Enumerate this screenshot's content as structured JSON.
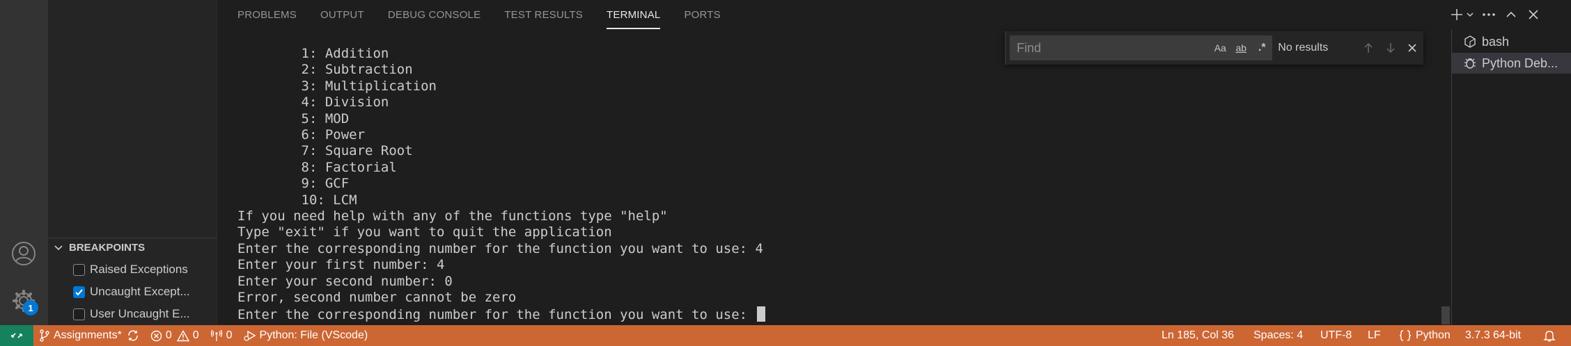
{
  "panel": {
    "tabs": [
      "PROBLEMS",
      "OUTPUT",
      "DEBUG CONSOLE",
      "TEST RESULTS",
      "TERMINAL",
      "PORTS"
    ],
    "active_tab": "TERMINAL"
  },
  "terminal": {
    "lines": [
      "        1: Addition",
      "        2: Subtraction",
      "        3: Multiplication",
      "        4: Division",
      "        5: MOD",
      "        6: Power",
      "        7: Square Root",
      "        8: Factorial",
      "        9: GCF",
      "        10: LCM",
      "If you need help with any of the functions type \"help\"",
      "Type \"exit\" if you want to quit the application",
      "Enter the corresponding number for the function you want to use: 4",
      "Enter your first number: 4",
      "Enter your second number: 0",
      "Error, second number cannot be zero",
      "Enter the corresponding number for the function you want to use: "
    ]
  },
  "find": {
    "placeholder": "Find",
    "value": "",
    "match_case_label": "Aa",
    "whole_word_label": "ab",
    "regex_label": ".*",
    "status": "No results"
  },
  "terminal_list": {
    "items": [
      {
        "label": "bash",
        "icon": "terminal-icon",
        "selected": false
      },
      {
        "label": "Python Deb...",
        "icon": "debug-icon",
        "selected": true
      }
    ]
  },
  "sidebar": {
    "breakpoints_title": "BREAKPOINTS",
    "breakpoints": [
      {
        "label": "Raised Exceptions",
        "checked": false
      },
      {
        "label": "Uncaught Except...",
        "checked": true
      },
      {
        "label": "User Uncaught E...",
        "checked": false
      }
    ]
  },
  "activity": {
    "settings_badge": "1"
  },
  "statusbar": {
    "branch": "Assignments*",
    "errors": "0",
    "warnings": "0",
    "ports": "0",
    "debug_config": "Python: File (VScode)",
    "cursor_position": "Ln 185, Col 36",
    "indentation": "Spaces: 4",
    "encoding": "UTF-8",
    "eol": "LF",
    "language": "Python",
    "interpreter": "3.7.3 64-bit"
  },
  "colors": {
    "statusbar_bg": "#cc6633",
    "remote_bg": "#16825d",
    "accent": "#0078d4"
  }
}
